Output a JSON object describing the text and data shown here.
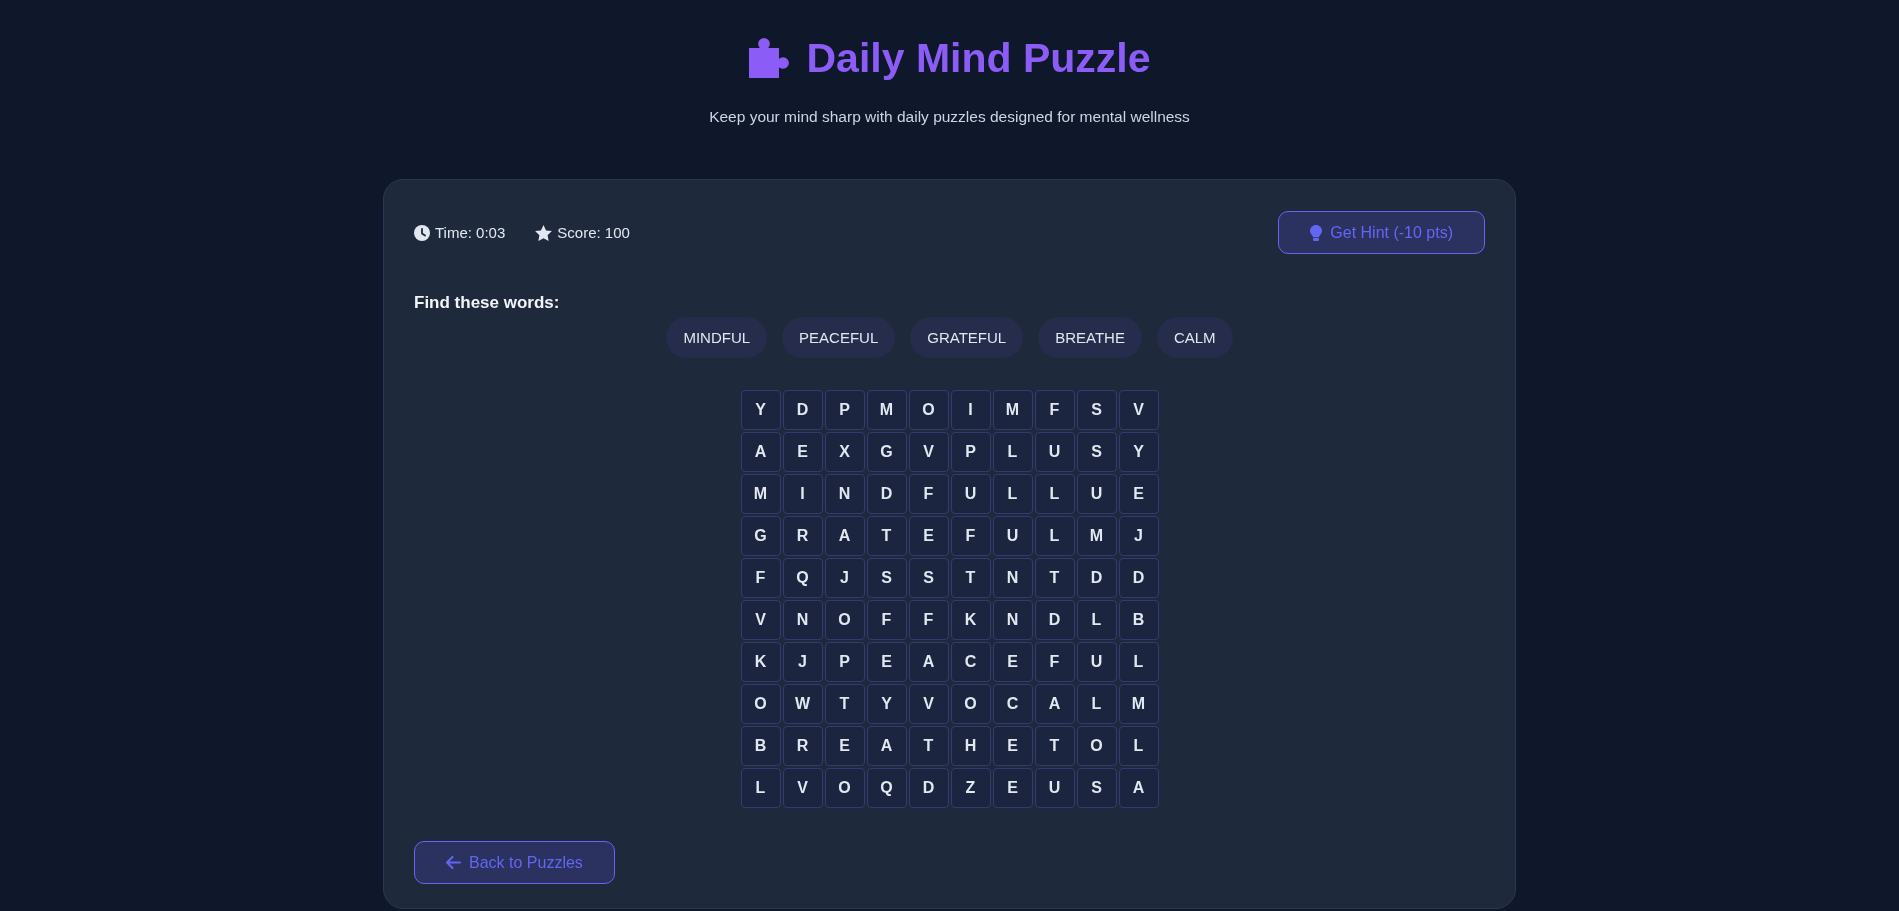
{
  "header": {
    "title": "Daily Mind Puzzle",
    "subtitle": "Keep your mind sharp with daily puzzles designed for mental wellness"
  },
  "stats": [
    {
      "kind": "time",
      "label": "Time: 0:03"
    },
    {
      "kind": "score",
      "label": "Score: 100"
    }
  ],
  "hint_button": {
    "label": "Get Hint (-10 pts)"
  },
  "word_list": {
    "heading": "Find these words:",
    "words": [
      "MINDFUL",
      "PEACEFUL",
      "GRATEFUL",
      "BREATHE",
      "CALM"
    ]
  },
  "grid": {
    "rows": [
      [
        "Y",
        "D",
        "P",
        "M",
        "O",
        "I",
        "M",
        "F",
        "S",
        "V"
      ],
      [
        "A",
        "E",
        "X",
        "G",
        "V",
        "P",
        "L",
        "U",
        "S",
        "Y"
      ],
      [
        "M",
        "I",
        "N",
        "D",
        "F",
        "U",
        "L",
        "L",
        "U",
        "E"
      ],
      [
        "G",
        "R",
        "A",
        "T",
        "E",
        "F",
        "U",
        "L",
        "M",
        "J"
      ],
      [
        "F",
        "Q",
        "J",
        "S",
        "S",
        "T",
        "N",
        "T",
        "D",
        "D"
      ],
      [
        "V",
        "N",
        "O",
        "F",
        "F",
        "K",
        "N",
        "D",
        "L",
        "B"
      ],
      [
        "K",
        "J",
        "P",
        "E",
        "A",
        "C",
        "E",
        "F",
        "U",
        "L"
      ],
      [
        "O",
        "W",
        "T",
        "Y",
        "V",
        "O",
        "C",
        "A",
        "L",
        "M"
      ],
      [
        "B",
        "R",
        "E",
        "A",
        "T",
        "H",
        "E",
        "T",
        "O",
        "L"
      ],
      [
        "L",
        "V",
        "O",
        "Q",
        "D",
        "Z",
        "E",
        "U",
        "S",
        "A"
      ]
    ]
  },
  "back_button": {
    "label": "Back to Puzzles"
  }
}
